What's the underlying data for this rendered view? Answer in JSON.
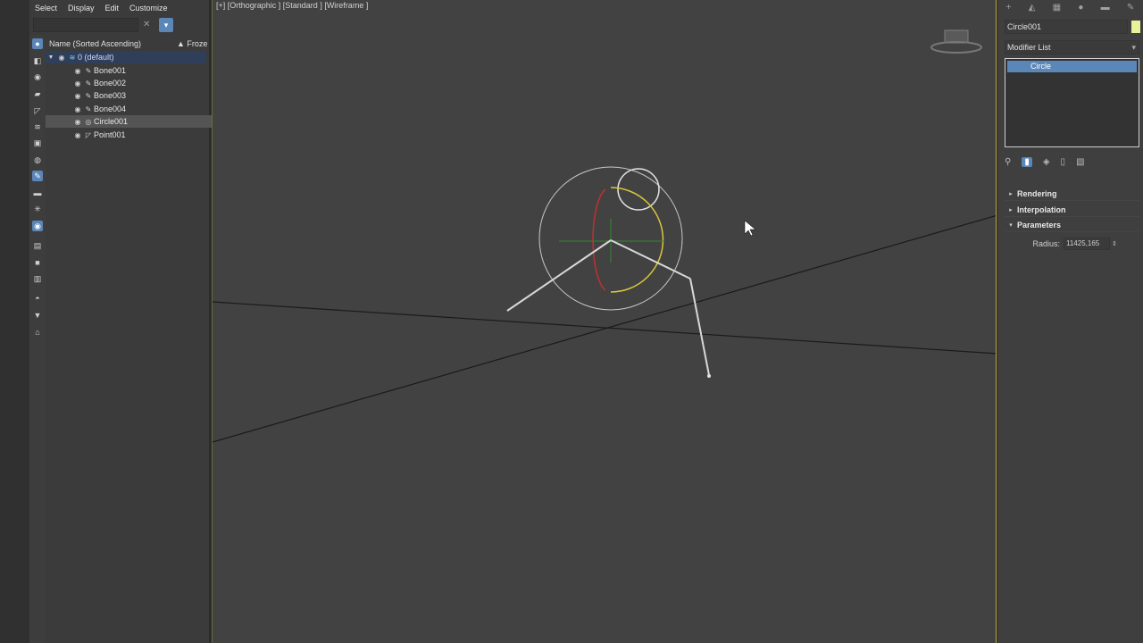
{
  "menu": [
    "Select",
    "Display",
    "Edit",
    "Customize"
  ],
  "scene_explorer": {
    "search_value": "",
    "columns": {
      "name": "Name (Sorted Ascending)",
      "frozen": "▲ Froze"
    },
    "layer": "0 (default)",
    "items": [
      "Bone001",
      "Bone002",
      "Bone003",
      "Bone004",
      "Circle001",
      "Point001"
    ]
  },
  "viewport": {
    "label": "[+] [Orthographic ] [Standard ] [Wireframe ]"
  },
  "command_panel": {
    "object_name": "Circle001",
    "object_color": "#e8f09a",
    "modifier_list": "Modifier List",
    "stack": [
      "Circle"
    ],
    "rollouts": [
      {
        "title": "Rendering",
        "state": "collapsed"
      },
      {
        "title": "Interpolation",
        "state": "collapsed"
      },
      {
        "title": "Parameters",
        "state": "expanded"
      }
    ],
    "params": {
      "radius_label": "Radius:",
      "radius_value": "11425,165"
    }
  }
}
